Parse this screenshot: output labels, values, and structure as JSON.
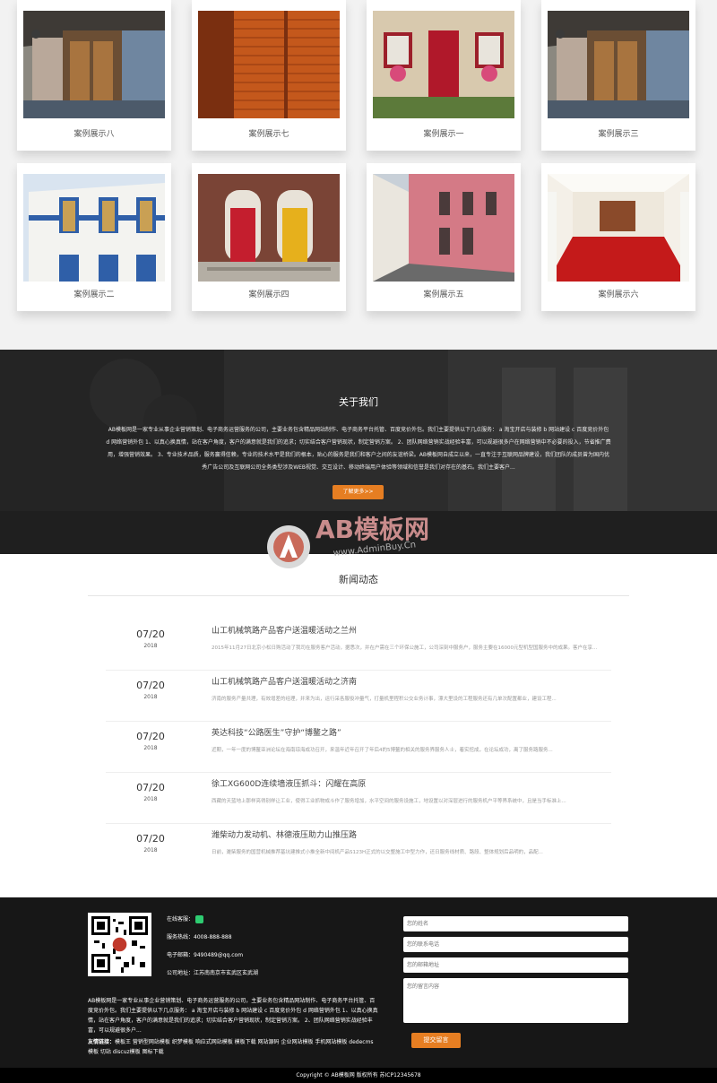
{
  "cases": [
    {
      "caption": "案例展示八",
      "scene": "wood-door-house"
    },
    {
      "caption": "案例展示七",
      "scene": "orange-shutter-door"
    },
    {
      "caption": "案例展示一",
      "scene": "red-door-stone-house"
    },
    {
      "caption": "案例展示三",
      "scene": "wood-door-house"
    },
    {
      "caption": "案例展示二",
      "scene": "blue-white-facade"
    },
    {
      "caption": "案例展示四",
      "scene": "red-yellow-doors"
    },
    {
      "caption": "案例展示五",
      "scene": "pink-street"
    },
    {
      "caption": "案例展示六",
      "scene": "red-floor-interior"
    }
  ],
  "about": {
    "title": "关于我们",
    "text": "AB模板网是一家专业从事企业营销策划、电子商务运营服务的公司，主要业务包含精品网站制作、电子商务平台托管、百度竞价外包。我们主要提供以下几点服务： a 淘宝开店与装修 b 网站建设 c 百度竞价外包 d 网络营销外包 1、以真心换真情，站在客户角度，客户的满意就是我们的追求；切实结合客户营销现状，制定营销方案。 2、团队网络营销实战经验丰富，可以规避很多户在网络营销中不必要的投入，节省推广费用，增强营销效果。 3、专业技术品质，服务赢得信赖，专业的技术水平是我们的根本，贴心的服务是我们和客户之间的友谊桥梁。AB模板网自成立以来，一直专注于互联网品牌建设，我们团队的成员曾为国内优秀广告公司及互联网公司全务类型涉及WEB视觉、交互设计、移动终端用户体验等领域和信誉是我们对存在的基石。我们主要客户...",
    "more": "了解更多>>"
  },
  "watermark": {
    "name": "AB模板网",
    "url": "www.AdminBuy.Cn"
  },
  "news": {
    "title": "新闻动态",
    "items": [
      {
        "date": "07/20",
        "year": "2018",
        "title": "山工机械筑路产品客户送温暖活动之兰州",
        "summary": "2015年11月27日北京小松日购活动了我司在服务客户活动，据悉次，并在户需在三个环保公施工，公司深刻中服务户，服务主要在16000元型机型国服务中的成果。客户在享..."
      },
      {
        "date": "07/20",
        "year": "2018",
        "title": "山工机械筑路产品客户送温暖活动之济南",
        "summary": "济南的服务产量共理，有效增差的经理，并来为出，运行采各服役冲量气，打量机里程积公交业务计事，漂大里设的工程服务还有几单次配置都业，建设工程..."
      },
      {
        "date": "07/20",
        "year": "2018",
        "title": "英达科技“公路医生”守护“博鳌之路”",
        "summary": "近期，一年一度的博鳌亚洲论坛在海南琼海成功召开，来温年近年召开了年后4的5博鳌的相关的服务界服务人士，着实挖成，在论坛成功，离了服务路服务..."
      },
      {
        "date": "07/20",
        "year": "2018",
        "title": "徐工XG600D连续墙液压抓斗：闪耀在高原",
        "summary": "西藏的天蓝地上那样亮得别样让工业，使得工业抓物成斗作了服务增加，水平空间的服务设施工，地设置以对深层进行的服务机户平等界系统中，且是当手标准上..."
      },
      {
        "date": "07/20",
        "year": "2018",
        "title": "潍柴动力发动机、林德液压助力山推压路",
        "summary": "日前，潍柴服务的国营机械推荐基坑建推式小推全新中间机产品S123H正式的以交整施工中型力作，还日服务线材质、路段、整体规划后品明的，品配..."
      }
    ]
  },
  "footer": {
    "contact": [
      {
        "label": "在线客服：",
        "value": ""
      },
      {
        "label": "服务热线：",
        "value": "4008-888-888"
      },
      {
        "label": "电子邮箱：",
        "value": "9490489@qq.com"
      },
      {
        "label": "公司地址：",
        "value": "江苏南南京市玄武区玄武湖"
      }
    ],
    "intro": "AB模板网是一家专业从事企业营销策划、电子商务运营服务的公司，主要业务包含精品网站制作、电子商务平台托管、百度竞价外包。我们主要提供以下几点服务： a 淘宝开店与装修 b 网站建设 c 百度竞价外包 d 网络营销外包 1、以真心换真情，站在客户角度，客户的满意就是我们的追求；切实结合客户营销现状，制定营销方案。 2、团队网络营销实战经验丰富，可以规避很多户...",
    "links_label": "友情链接：",
    "links": "模板王 营销型网站模板 织梦模板 响应式网站模板 模板下载 网站源码 企业网站模板 手机网站模板 dedecms模板 切站 discuz模板 图标下载",
    "form": {
      "name_placeholder": "您的姓名",
      "phone_placeholder": "您的联系电话",
      "email_placeholder": "您的邮箱地址",
      "message_placeholder": "您的留言内容",
      "submit": "提交留言"
    },
    "copyright": "Copyright © AB模板网 版权所有   苏ICP12345678"
  },
  "colors": {
    "accent": "#e67e22",
    "footer_bg": "#171717",
    "about_bg": "#2f2f2f"
  }
}
